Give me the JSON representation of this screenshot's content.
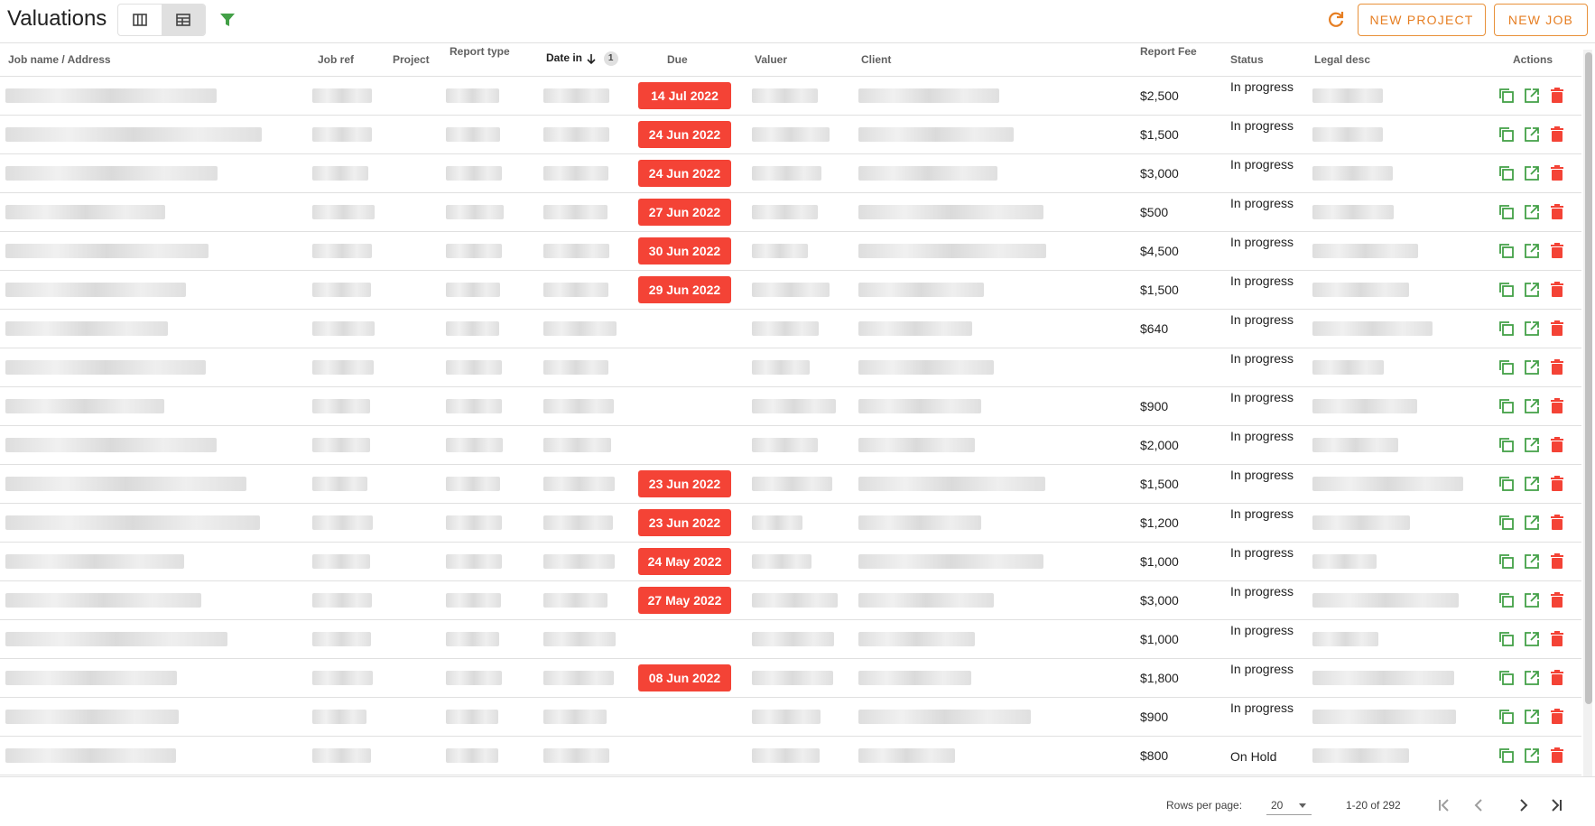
{
  "header": {
    "title": "Valuations",
    "new_project_label": "NEW PROJECT",
    "new_job_label": "NEW JOB",
    "accent_color": "#e67e22",
    "filter_color": "#43a047"
  },
  "table": {
    "columns": {
      "job_name": "Job name / Address",
      "job_ref": "Job ref",
      "project": "Project",
      "report_type": "Report type",
      "date_in": "Date in",
      "date_in_sort_order": "1",
      "due": "Due",
      "valuer": "Valuer",
      "client": "Client",
      "report_fee": "Report Fee",
      "status": "Status",
      "legal_desc": "Legal desc",
      "actions": "Actions"
    },
    "rows": [
      {
        "due": "14 Jul 2022",
        "fee": "$2,500",
        "status": "In progress"
      },
      {
        "due": "24 Jun 2022",
        "fee": "$1,500",
        "status": "In progress"
      },
      {
        "due": "24 Jun 2022",
        "fee": "$3,000",
        "status": "In progress"
      },
      {
        "due": "27 Jun 2022",
        "fee": "$500",
        "status": "In progress"
      },
      {
        "due": "30 Jun 2022",
        "fee": "$4,500",
        "status": "In progress"
      },
      {
        "due": "29 Jun 2022",
        "fee": "$1,500",
        "status": "In progress"
      },
      {
        "due": "",
        "fee": "$640",
        "status": "In progress"
      },
      {
        "due": "",
        "fee": "",
        "status": "In progress"
      },
      {
        "due": "",
        "fee": "$900",
        "status": "In progress"
      },
      {
        "due": "",
        "fee": "$2,000",
        "status": "In progress"
      },
      {
        "due": "23 Jun 2022",
        "fee": "$1,500",
        "status": "In progress"
      },
      {
        "due": "23 Jun 2022",
        "fee": "$1,200",
        "status": "In progress"
      },
      {
        "due": "24 May 2022",
        "fee": "$1,000",
        "status": "In progress"
      },
      {
        "due": "27 May 2022",
        "fee": "$3,000",
        "status": "In progress"
      },
      {
        "due": "",
        "fee": "$1,000",
        "status": "In progress"
      },
      {
        "due": "08 Jun 2022",
        "fee": "$1,800",
        "status": "In progress"
      },
      {
        "due": "",
        "fee": "$900",
        "status": "In progress"
      },
      {
        "due": "",
        "fee": "$800",
        "status": "On Hold"
      },
      {
        "due": "",
        "fee": "",
        "status": ""
      }
    ],
    "overdue_color": "#f44336",
    "action_icons": [
      "copy-icon",
      "open-external-icon",
      "delete-icon"
    ]
  },
  "footer": {
    "rows_per_page_label": "Rows per page:",
    "rows_per_page_value": "20",
    "range_text": "1-20 of 292"
  }
}
